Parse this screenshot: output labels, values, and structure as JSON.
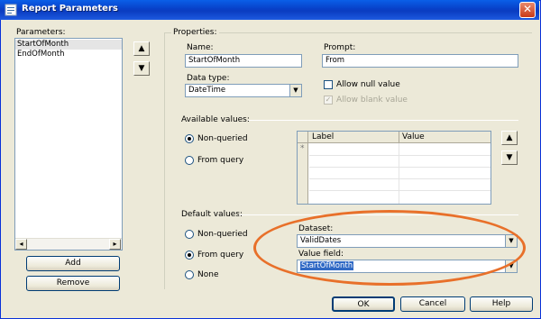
{
  "window": {
    "title": "Report Parameters",
    "close_label": "✕"
  },
  "parameters": {
    "heading": "Parameters:",
    "items": [
      "StartOfMonth",
      "EndOfMonth"
    ],
    "add_label": "Add",
    "remove_label": "Remove",
    "scroll_left": "◂",
    "scroll_right": "▸"
  },
  "move": {
    "up": "▲",
    "down": "▼"
  },
  "properties": {
    "heading": "Properties:",
    "name_label": "Name:",
    "name_value": "StartOfMonth",
    "prompt_label": "Prompt:",
    "prompt_value": "From",
    "data_type_label": "Data type:",
    "data_type_value": "DateTime",
    "allow_null_label": "Allow null value",
    "allow_blank_label": "Allow blank value",
    "allow_blank_checked": "✓"
  },
  "available_values": {
    "heading": "Available values:",
    "non_queried_label": "Non-queried",
    "from_query_label": "From query",
    "col_label": "Label",
    "col_value": "Value",
    "new_row_marker": "*"
  },
  "default_values": {
    "heading": "Default values:",
    "non_queried_label": "Non-queried",
    "from_query_label": "From query",
    "none_label": "None",
    "dataset_label": "Dataset:",
    "dataset_value": "ValidDates",
    "value_field_label": "Value field:",
    "value_field_value": "StartOfMonth"
  },
  "footer": {
    "ok_label": "OK",
    "cancel_label": "Cancel",
    "help_label": "Help"
  },
  "combo_arrow": "▼",
  "colors": {
    "titlebar": "#0a5fe8",
    "annotation": "#e8702a",
    "selection": "#316ac5"
  }
}
